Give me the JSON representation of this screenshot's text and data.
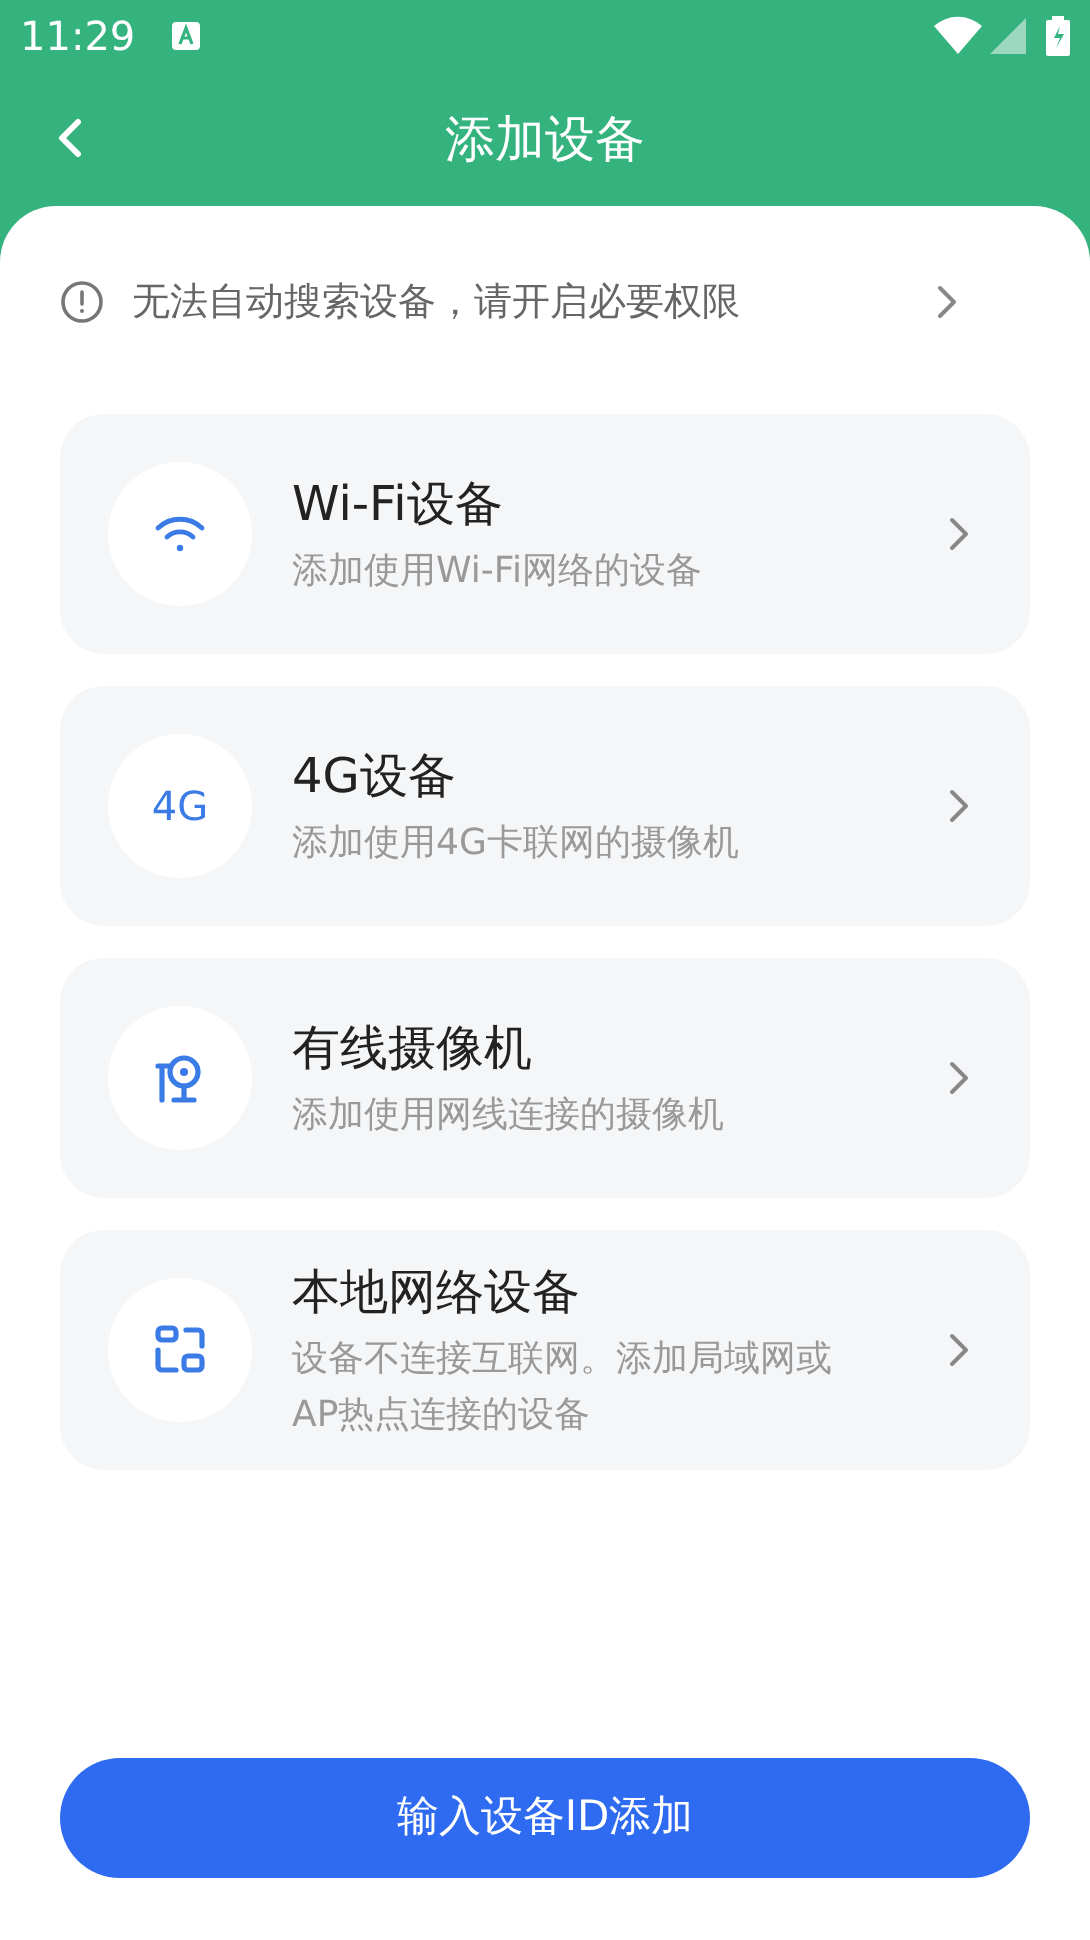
{
  "status_bar": {
    "time": "11:29"
  },
  "header": {
    "title": "添加设备"
  },
  "notice": {
    "text": "无法自动搜索设备，请开启必要权限"
  },
  "devices": [
    {
      "kind": "wifi",
      "title": "Wi-Fi设备",
      "subtitle": "添加使用Wi-Fi网络的设备"
    },
    {
      "kind": "text",
      "icon_text": "4G",
      "title": "4G设备",
      "subtitle": "添加使用4G卡联网的摄像机"
    },
    {
      "kind": "camera",
      "title": "有线摄像机",
      "subtitle": "添加使用网线连接的摄像机"
    },
    {
      "kind": "local",
      "title": "本地网络设备",
      "subtitle": "设备不连接互联网。添加局域网或AP热点连接的设备"
    }
  ],
  "primary_button": {
    "label": "输入设备ID添加"
  }
}
